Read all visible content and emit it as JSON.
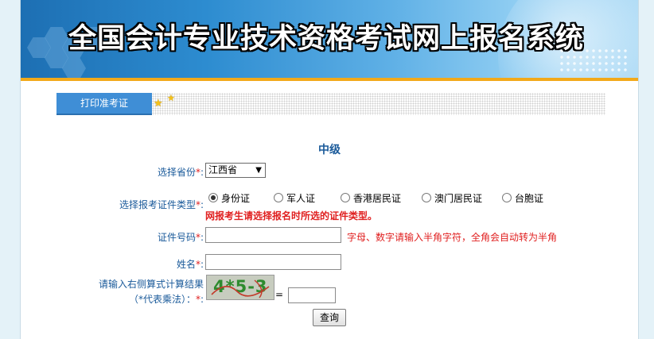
{
  "header": {
    "title": "全国会计专业技术资格考试网上报名系统"
  },
  "tab": {
    "label": "打印准考证"
  },
  "form": {
    "level": "中级",
    "required_mark": "*",
    "colon": ":",
    "province": {
      "label": "选择省份",
      "selected": "江西省"
    },
    "id_type": {
      "label": "选择报考证件类型",
      "options": [
        "身份证",
        "军人证",
        "香港居民证",
        "澳门居民证",
        "台胞证"
      ],
      "selected_index": 0,
      "hint": "网报考生请选择报名时所选的证件类型。"
    },
    "id_number": {
      "label": "证件号码",
      "value": "",
      "hint": "字母、数字请输入半角字符，全角会自动转为半角"
    },
    "name": {
      "label": "姓名",
      "value": ""
    },
    "captcha": {
      "label_line1": "请输入右侧算式计算结果",
      "label_line2": "（*代表乘法）：",
      "image_text": "4*5-3",
      "equals": "=",
      "value": ""
    },
    "submit_label": "查询"
  },
  "colors": {
    "accent": "#f2a91a",
    "tab": "#3f8ed6",
    "label": "#1a5a9a",
    "required": "#e02020"
  }
}
